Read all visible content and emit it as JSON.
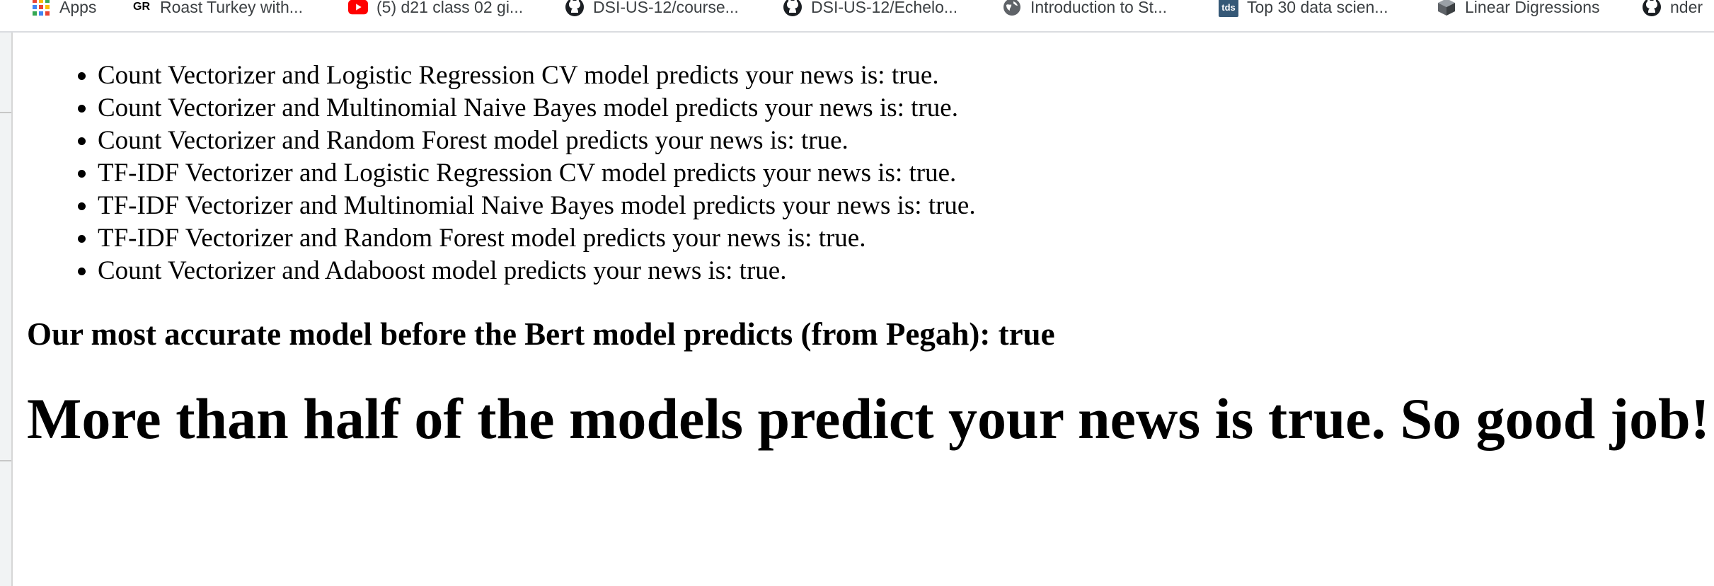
{
  "bookmarks": [
    {
      "label": "Apps",
      "icon": "apps-grid-icon"
    },
    {
      "label": "Roast Turkey with...",
      "icon": "gr-icon",
      "icon_text": "GR"
    },
    {
      "label": "(5) d21 class 02 gi...",
      "icon": "youtube-icon"
    },
    {
      "label": "DSI-US-12/course...",
      "icon": "github-icon"
    },
    {
      "label": "DSI-US-12/Echelo...",
      "icon": "github-icon"
    },
    {
      "label": "Introduction to St...",
      "icon": "globe-icon"
    },
    {
      "label": "Top 30 data scien...",
      "icon": "tds-icon",
      "icon_text": "tds"
    },
    {
      "label": "Linear Digressions",
      "icon": "cube-icon"
    },
    {
      "label": "nder",
      "icon": "github-icon"
    }
  ],
  "results": [
    "Count Vectorizer and Logistic Regression CV model predicts your news is: true.",
    "Count Vectorizer and Multinomial Naive Bayes model predicts your news is: true.",
    "Count Vectorizer and Random Forest model predicts your news is: true.",
    "TF-IDF Vectorizer and Logistic Regression CV model predicts your news is: true.",
    "TF-IDF Vectorizer and Multinomial Naive Bayes model predicts your news is: true.",
    "TF-IDF Vectorizer and Random Forest model predicts your news is: true.",
    "Count Vectorizer and Adaboost model predicts your news is: true."
  ],
  "best_model": "Our most accurate model before the Bert model predicts (from Pegah): true",
  "verdict": "More than half of the models predict your news is true. So good job!",
  "colors": {
    "apps_grid": [
      "#ea4335",
      "#fbbc04",
      "#34a853",
      "#4285f4"
    ],
    "youtube_red": "#ff0000",
    "tds_bg": "#355876",
    "github_black": "#1b1f23",
    "globe_gray": "#5f6368",
    "cube_gray": "#5f6368"
  }
}
